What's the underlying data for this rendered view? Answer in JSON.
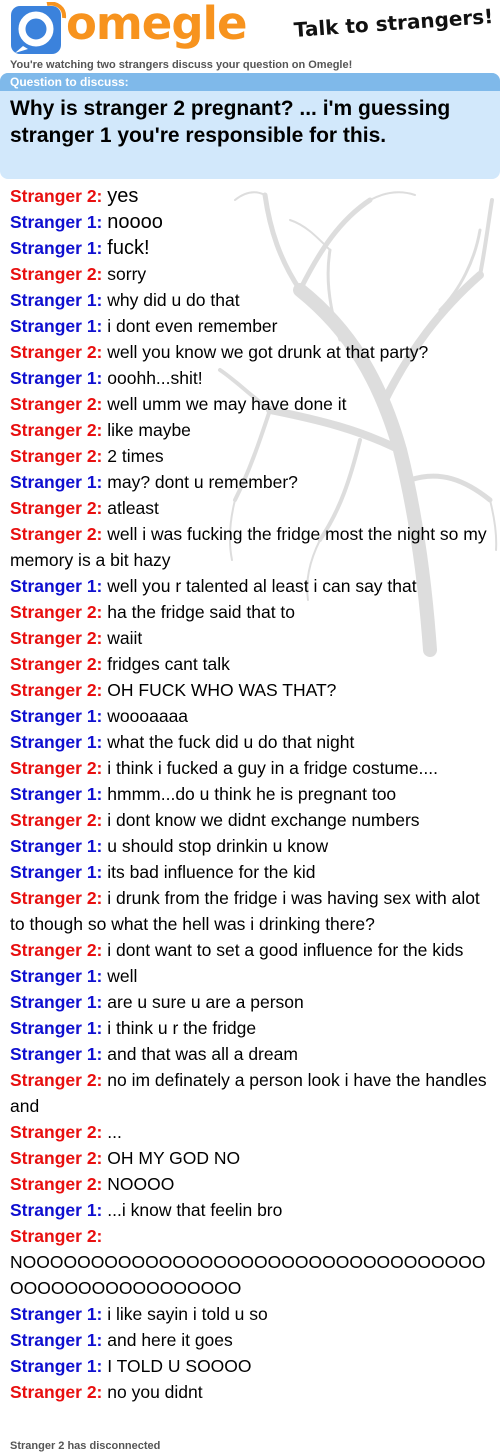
{
  "header": {
    "logo_text": "omegle",
    "tagline": "Talk to strangers!",
    "watching": "You're watching two strangers discuss your question on Omegle!"
  },
  "question": {
    "label": "Question to discuss:",
    "text": "Why is stranger 2 pregnant? ... i'm guessing stranger 1 you're responsible for this."
  },
  "colors": {
    "stranger1": "#0f0fd0",
    "stranger2": "#e80f0f",
    "brand": "#f7931e",
    "question_bg": "#d2e8fb",
    "label_bg": "#7fb9ea"
  },
  "messages": [
    {
      "who": "Stranger 2:",
      "side": 2,
      "text": "yes",
      "big": true
    },
    {
      "who": "Stranger 1:",
      "side": 1,
      "text": "noooo",
      "big": true
    },
    {
      "who": "Stranger 1:",
      "side": 1,
      "text": "fuck!",
      "big": true
    },
    {
      "who": "Stranger 2:",
      "side": 2,
      "text": "sorry"
    },
    {
      "who": "Stranger 1:",
      "side": 1,
      "text": "why did u do that"
    },
    {
      "who": "Stranger 1:",
      "side": 1,
      "text": "i dont even remember"
    },
    {
      "who": "Stranger 2:",
      "side": 2,
      "text": "well you know we got drunk at that party?"
    },
    {
      "who": "Stranger 1:",
      "side": 1,
      "text": "ooohh...shit!"
    },
    {
      "who": "Stranger 2:",
      "side": 2,
      "text": "well umm we may have done it"
    },
    {
      "who": "Stranger 2:",
      "side": 2,
      "text": "like maybe"
    },
    {
      "who": "Stranger 2:",
      "side": 2,
      "text": "2 times"
    },
    {
      "who": "Stranger 1:",
      "side": 1,
      "text": "may? dont u remember?"
    },
    {
      "who": "Stranger 2:",
      "side": 2,
      "text": "atleast"
    },
    {
      "who": "Stranger 2:",
      "side": 2,
      "text": "well i was fucking the fridge most the night so my memory is a bit hazy"
    },
    {
      "who": "Stranger 1:",
      "side": 1,
      "text": "well you r talented al least i can say that"
    },
    {
      "who": "Stranger 2:",
      "side": 2,
      "text": "ha the fridge said that to"
    },
    {
      "who": "Stranger 2:",
      "side": 2,
      "text": "waiit"
    },
    {
      "who": "Stranger 2:",
      "side": 2,
      "text": "fridges cant talk"
    },
    {
      "who": "Stranger 2:",
      "side": 2,
      "text": "OH FUCK WHO WAS THAT?"
    },
    {
      "who": "Stranger 1:",
      "side": 1,
      "text": "woooaaaa"
    },
    {
      "who": "Stranger 1:",
      "side": 1,
      "text": "what the fuck did u do that night"
    },
    {
      "who": "Stranger 2:",
      "side": 2,
      "text": "i think i fucked a guy in a fridge costume...."
    },
    {
      "who": "Stranger 1:",
      "side": 1,
      "text": "hmmm...do u think he is pregnant too"
    },
    {
      "who": "Stranger 2:",
      "side": 2,
      "text": "i dont know we didnt exchange numbers"
    },
    {
      "who": "Stranger 1:",
      "side": 1,
      "text": "u should stop drinkin u know"
    },
    {
      "who": "Stranger 1:",
      "side": 1,
      "text": "its bad influence for the kid"
    },
    {
      "who": "Stranger 2:",
      "side": 2,
      "text": "i drunk from the fridge i was having sex with alot to though so what the hell was i drinking there?"
    },
    {
      "who": "Stranger 2:",
      "side": 2,
      "text": "i dont want to set a good influence for the kids"
    },
    {
      "who": "Stranger 1:",
      "side": 1,
      "text": "well"
    },
    {
      "who": "Stranger 1:",
      "side": 1,
      "text": "are u sure u are a person"
    },
    {
      "who": "Stranger 1:",
      "side": 1,
      "text": "i think u r the fridge"
    },
    {
      "who": "Stranger 1:",
      "side": 1,
      "text": "and that was all a dream"
    },
    {
      "who": "Stranger 2:",
      "side": 2,
      "text": "no im definately a person look i have the handles and"
    },
    {
      "who": "Stranger 2:",
      "side": 2,
      "text": "..."
    },
    {
      "who": "Stranger 2:",
      "side": 2,
      "text": "OH MY GOD NO"
    },
    {
      "who": "Stranger 2:",
      "side": 2,
      "text": "NOOOO"
    },
    {
      "who": "Stranger 1:",
      "side": 1,
      "text": "...i know that feelin bro"
    },
    {
      "who": "Stranger 2:",
      "side": 2,
      "text": "NOOOOOOOOOOOOOOOOOOOOOOOOOOOOOOOOOOOOOOOOOOOOOOOOOOO",
      "block": true
    },
    {
      "who": "Stranger 1:",
      "side": 1,
      "text": "i like sayin i told u so"
    },
    {
      "who": "Stranger 1:",
      "side": 1,
      "text": "and here it goes"
    },
    {
      "who": "Stranger 1:",
      "side": 1,
      "text": "I TOLD U SOOOO"
    },
    {
      "who": "Stranger 2:",
      "side": 2,
      "text": "no you didnt"
    }
  ],
  "status": "Stranger 2 has disconnected"
}
